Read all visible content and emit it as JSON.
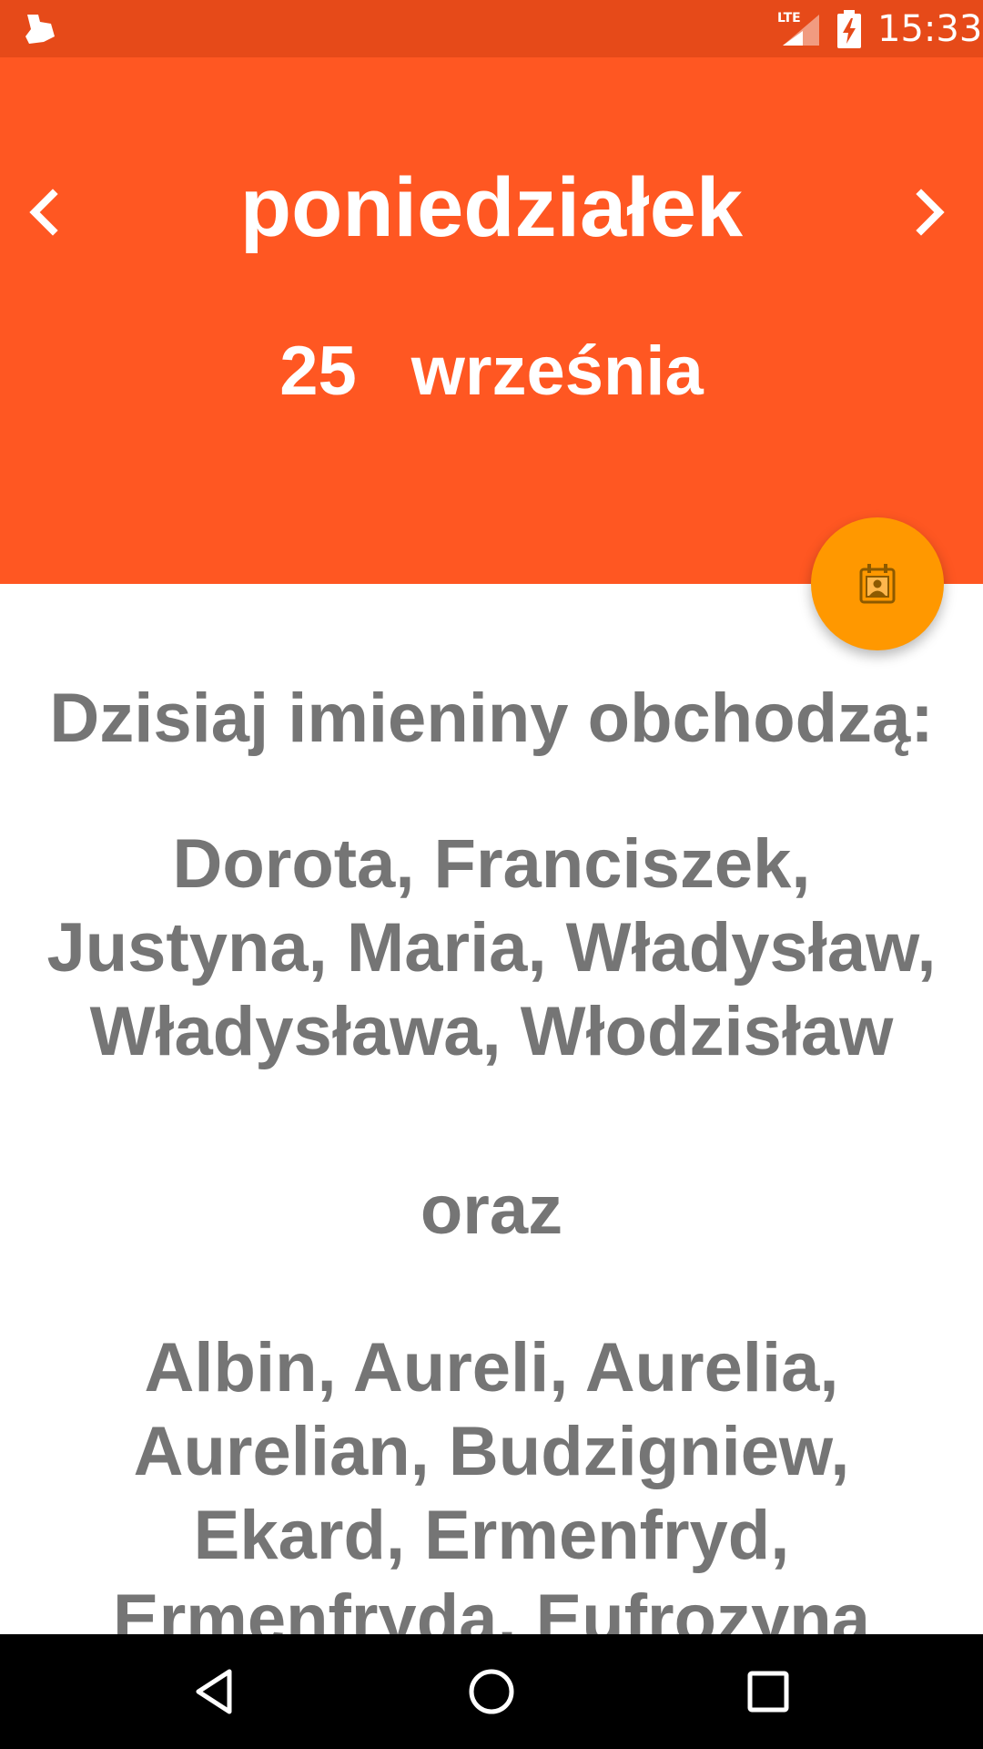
{
  "status_bar": {
    "network": "LTE",
    "time": "15:33",
    "notification_icon": "app-notification-icon",
    "battery_icon": "battery-charging-icon"
  },
  "header": {
    "day_name": "poniedziałek",
    "day_number": "25",
    "month": "września",
    "prev_icon": "chevron-left-icon",
    "next_icon": "chevron-right-icon",
    "background_color": "#FF5722"
  },
  "fab": {
    "icon": "calendar-contact-icon",
    "color": "#FF9800"
  },
  "content": {
    "heading": "Dzisiaj imieniny obchodzą:",
    "primary_names": "Dorota, Franciszek, Justyna, Maria, Władysław, Władysława, Włodzisław",
    "conjunction": "oraz",
    "secondary_names": "Albin, Aureli, Aurelia, Aurelian, Budzigniew, Ekard, Ermenfryd, Ermenfryda, Eufrozyna",
    "text_color": "#757575"
  },
  "nav_bar": {
    "back_icon": "back-triangle-icon",
    "home_icon": "home-circle-icon",
    "recents_icon": "recents-square-icon"
  }
}
